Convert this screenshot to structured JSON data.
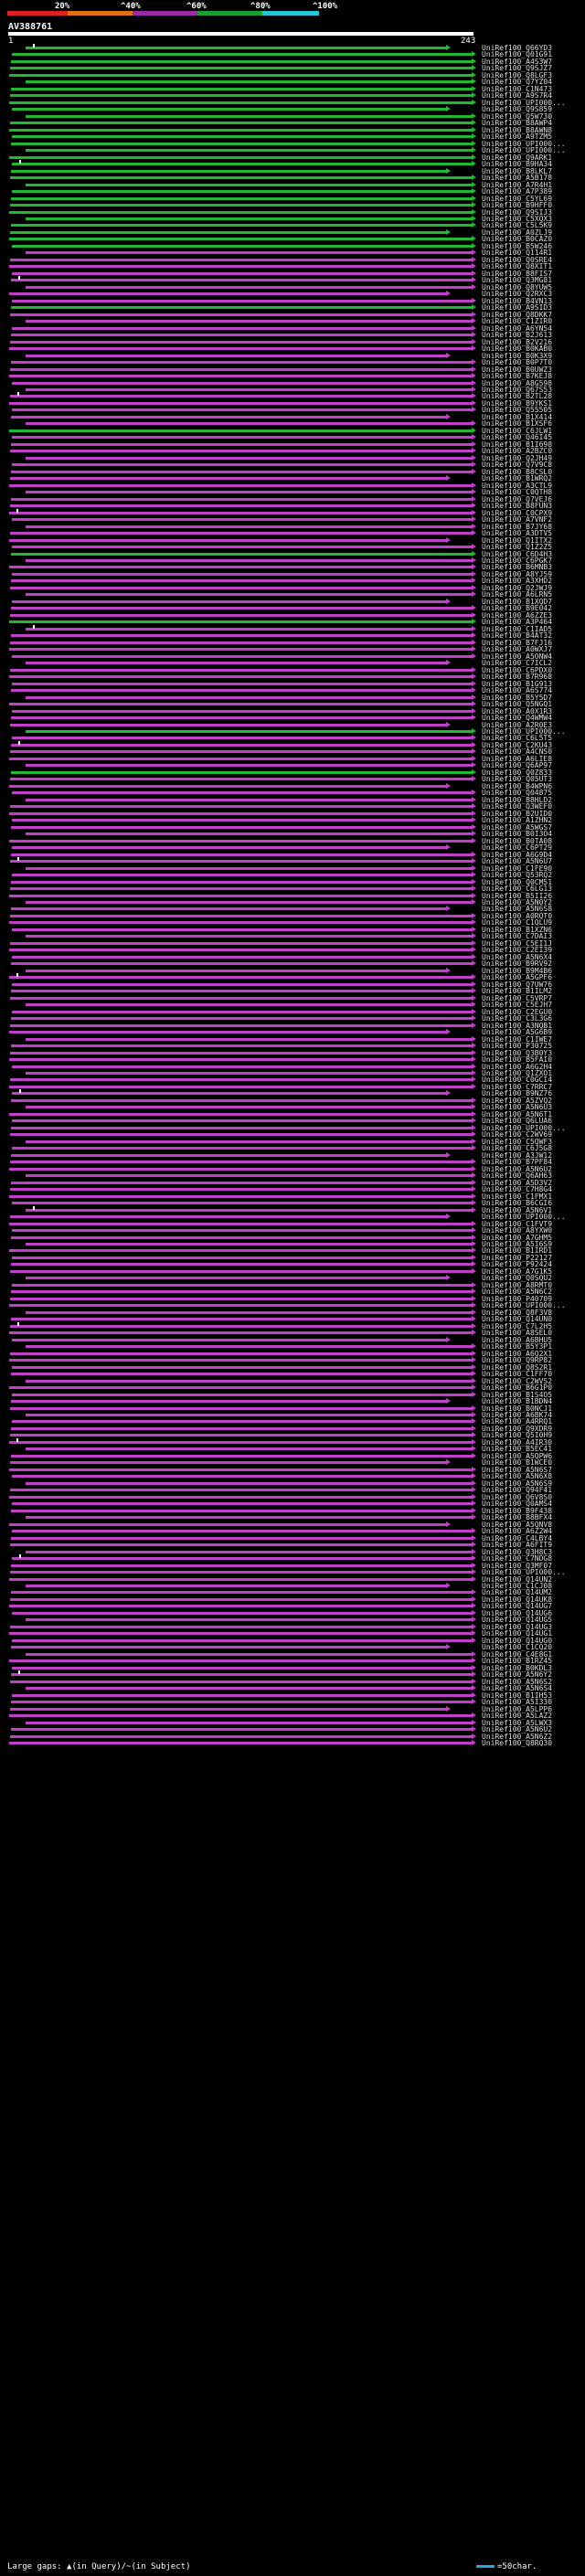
{
  "scale": {
    "labels": [
      "20%",
      "^40%",
      "^60%",
      "^80%",
      "^100%"
    ],
    "colors": [
      "#e02020",
      "#e07010",
      "#9a2aa8",
      "#1aa030",
      "#20c8d8"
    ]
  },
  "query": {
    "title": "AV388761",
    "start_label": "1",
    "end_label": "243"
  },
  "legend": {
    "text": "Large gaps: ▲(in Query)/~(in Subject)",
    "scale_text": "=50char."
  },
  "hits": [
    {
      "label": "UniRef100_Q66YD3",
      "color": "green"
    },
    {
      "label": "UniRef100_Q01G91",
      "color": "green"
    },
    {
      "label": "UniRef100_A4S3W7",
      "color": "green"
    },
    {
      "label": "UniRef100_Q9SJZ7",
      "color": "green"
    },
    {
      "label": "UniRef100_Q8LGF3",
      "color": "green"
    },
    {
      "label": "UniRef100_Q7YZ04",
      "color": "green"
    },
    {
      "label": "UniRef100_C1N473",
      "color": "green"
    },
    {
      "label": "UniRef100_A9S7R4",
      "color": "green"
    },
    {
      "label": "UniRef100_UPI000...",
      "color": "green"
    },
    {
      "label": "UniRef100_Q9S859",
      "color": "green"
    },
    {
      "label": "UniRef100_Q5W730",
      "color": "green"
    },
    {
      "label": "UniRef100_B8AWP4",
      "color": "green"
    },
    {
      "label": "UniRef100_B8AWN8",
      "color": "green"
    },
    {
      "label": "UniRef100_A9TZM5",
      "color": "green"
    },
    {
      "label": "UniRef100_UPI000...",
      "color": "green"
    },
    {
      "label": "UniRef100_UPI000...",
      "color": "green"
    },
    {
      "label": "UniRef100_Q9ARK1",
      "color": "green"
    },
    {
      "label": "UniRef100_B9HA34",
      "color": "green"
    },
    {
      "label": "UniRef100_B8LKL7",
      "color": "green"
    },
    {
      "label": "UniRef100_A5B178",
      "color": "green"
    },
    {
      "label": "UniRef100_A7R4H1",
      "color": "green"
    },
    {
      "label": "UniRef100_A7P389",
      "color": "green"
    },
    {
      "label": "UniRef100_C5YL69",
      "color": "green"
    },
    {
      "label": "UniRef100_B9HFF0",
      "color": "green"
    },
    {
      "label": "UniRef100_Q9SIJ3",
      "color": "green"
    },
    {
      "label": "UniRef100_C5XQX3",
      "color": "green"
    },
    {
      "label": "UniRef100_C5L5K9",
      "color": "green"
    },
    {
      "label": "UniRef100_A0ZLJ9",
      "color": "green"
    },
    {
      "label": "UniRef100_B0CAZ0",
      "color": "green"
    },
    {
      "label": "UniRef100_B5W246",
      "color": "green"
    },
    {
      "label": "UniRef100_Q114R1",
      "color": "magenta"
    },
    {
      "label": "UniRef100_Q0SRE4",
      "color": "magenta"
    },
    {
      "label": "UniRef100_Q8XIT1",
      "color": "magenta"
    },
    {
      "label": "UniRef100_B8FIS7",
      "color": "magenta"
    },
    {
      "label": "UniRef100_Q3MG81",
      "color": "magenta"
    },
    {
      "label": "UniRef100_Q8YUW5",
      "color": "magenta"
    },
    {
      "label": "UniRef100_Q2RXC3",
      "color": "magenta"
    },
    {
      "label": "UniRef100_B4VN13",
      "color": "magenta"
    },
    {
      "label": "UniRef100_A9SID3",
      "color": "green"
    },
    {
      "label": "UniRef100_Q8DKK7",
      "color": "magenta"
    },
    {
      "label": "UniRef100_C1ZIR0",
      "color": "magenta"
    },
    {
      "label": "UniRef100_A6YN54",
      "color": "magenta"
    },
    {
      "label": "UniRef100_B2J613",
      "color": "magenta"
    },
    {
      "label": "UniRef100_B2V216",
      "color": "magenta"
    },
    {
      "label": "UniRef100_B0KAB0",
      "color": "magenta"
    },
    {
      "label": "UniRef100_B0K3X9",
      "color": "magenta"
    },
    {
      "label": "UniRef100_B0P7T0",
      "color": "magenta"
    },
    {
      "label": "UniRef100_B0UWZ3",
      "color": "magenta"
    },
    {
      "label": "UniRef100_B7KEJ8",
      "color": "magenta"
    },
    {
      "label": "UniRef100_A8G598",
      "color": "magenta"
    },
    {
      "label": "UniRef100_Q67S53",
      "color": "magenta"
    },
    {
      "label": "UniRef100_B2TL28",
      "color": "magenta"
    },
    {
      "label": "UniRef100_B9YKS1",
      "color": "magenta"
    },
    {
      "label": "UniRef100_Q55505",
      "color": "magenta"
    },
    {
      "label": "UniRef100_B1X414",
      "color": "magenta"
    },
    {
      "label": "UniRef100_B1XSF6",
      "color": "magenta"
    },
    {
      "label": "UniRef100_C6JLW1",
      "color": "green"
    },
    {
      "label": "UniRef100_Q46I45",
      "color": "magenta"
    },
    {
      "label": "UniRef100_B1I698",
      "color": "magenta"
    },
    {
      "label": "UniRef100_A2BZC0",
      "color": "magenta"
    },
    {
      "label": "UniRef100_Q2JH49",
      "color": "magenta"
    },
    {
      "label": "UniRef100_Q7V9C8",
      "color": "magenta"
    },
    {
      "label": "UniRef100_B8CSL0",
      "color": "magenta"
    },
    {
      "label": "UniRef100_B1WRQ2",
      "color": "magenta"
    },
    {
      "label": "UniRef100_A3CTL9",
      "color": "magenta"
    },
    {
      "label": "UniRef100_C0QTH8",
      "color": "magenta"
    },
    {
      "label": "UniRef100_Q7VEJ6",
      "color": "magenta"
    },
    {
      "label": "UniRef100_B8FUN3",
      "color": "magenta"
    },
    {
      "label": "UniRef100_C0CPX9",
      "color": "magenta"
    },
    {
      "label": "UniRef100_A7VNF2",
      "color": "magenta"
    },
    {
      "label": "UniRef100_B7JY68",
      "color": "magenta"
    },
    {
      "label": "UniRef100_A3DTV5",
      "color": "magenta"
    },
    {
      "label": "UniRef100_Q1ITX2",
      "color": "magenta"
    },
    {
      "label": "UniRef100_Q1Z2Z5",
      "color": "magenta"
    },
    {
      "label": "UniRef100_C6D4H3",
      "color": "green"
    },
    {
      "label": "UniRef100_C6PGK7",
      "color": "magenta"
    },
    {
      "label": "UniRef100_B6MNB3",
      "color": "magenta"
    },
    {
      "label": "UniRef100_A8YJ59",
      "color": "magenta"
    },
    {
      "label": "UniRef100_A3XHD2",
      "color": "magenta"
    },
    {
      "label": "UniRef100_Q2JWJ9",
      "color": "magenta"
    },
    {
      "label": "UniRef100_A6LRN5",
      "color": "magenta"
    },
    {
      "label": "UniRef100_B1XQD7",
      "color": "magenta"
    },
    {
      "label": "UniRef100_B9E042",
      "color": "magenta"
    },
    {
      "label": "UniRef100_A6ZZE3",
      "color": "magenta"
    },
    {
      "label": "UniRef100_A3P464",
      "color": "green"
    },
    {
      "label": "UniRef100_C1IAD5",
      "color": "magenta"
    },
    {
      "label": "UniRef100_B4AT32",
      "color": "magenta"
    },
    {
      "label": "UniRef100_B7FJ16",
      "color": "magenta"
    },
    {
      "label": "UniRef100_A0WXJ7",
      "color": "magenta"
    },
    {
      "label": "UniRef100_A5ONW4",
      "color": "magenta"
    },
    {
      "label": "UniRef100_C7ICL2",
      "color": "magenta"
    },
    {
      "label": "UniRef100_C6PDX0",
      "color": "magenta"
    },
    {
      "label": "UniRef100_B7R968",
      "color": "magenta"
    },
    {
      "label": "UniRef100_B1G913",
      "color": "magenta"
    },
    {
      "label": "UniRef100_A6S774",
      "color": "magenta"
    },
    {
      "label": "UniRef100_B5Y5D7",
      "color": "magenta"
    },
    {
      "label": "UniRef100_Q5NGQ1",
      "color": "magenta"
    },
    {
      "label": "UniRef100_A0X1R3",
      "color": "magenta"
    },
    {
      "label": "UniRef100_Q4WMW4",
      "color": "magenta"
    },
    {
      "label": "UniRef100_A2R0E3",
      "color": "magenta"
    },
    {
      "label": "UniRef100_UPI000...",
      "color": "green"
    },
    {
      "label": "UniRef100_C6L5T5",
      "color": "magenta"
    },
    {
      "label": "UniRef100_C2KU43",
      "color": "magenta"
    },
    {
      "label": "UniRef100_A4CNS0",
      "color": "magenta"
    },
    {
      "label": "UniRef100_A6LIE8",
      "color": "magenta"
    },
    {
      "label": "UniRef100_Q6AP97",
      "color": "magenta"
    },
    {
      "label": "UniRef100_Q0Z833",
      "color": "green"
    },
    {
      "label": "UniRef100_Q05UT3",
      "color": "magenta"
    },
    {
      "label": "UniRef100_B4WPN6",
      "color": "magenta"
    },
    {
      "label": "UniRef100_Q04875",
      "color": "magenta"
    },
    {
      "label": "UniRef100_B8HLD2",
      "color": "magenta"
    },
    {
      "label": "UniRef100_Q3WEF0",
      "color": "magenta"
    },
    {
      "label": "UniRef100_B2UID0",
      "color": "magenta"
    },
    {
      "label": "UniRef100_A1ZHN2",
      "color": "magenta"
    },
    {
      "label": "UniRef100_A5WGS7",
      "color": "magenta"
    },
    {
      "label": "UniRef100_B0I3O4",
      "color": "magenta"
    },
    {
      "label": "UniRef100_B0TA08",
      "color": "magenta"
    },
    {
      "label": "UniRef100_C6PT29",
      "color": "magenta"
    },
    {
      "label": "UniRef100_A6G9D4",
      "color": "magenta"
    },
    {
      "label": "UniRef100_A5N6U7",
      "color": "magenta"
    },
    {
      "label": "UniRef100_C1FE90",
      "color": "magenta"
    },
    {
      "label": "UniRef100_Q53RQ2",
      "color": "magenta"
    },
    {
      "label": "UniRef100_Q0CM51",
      "color": "magenta"
    },
    {
      "label": "UniRef100_C6LG13",
      "color": "magenta"
    },
    {
      "label": "UniRef100_B5II26",
      "color": "magenta"
    },
    {
      "label": "UniRef100_A5N0Y2",
      "color": "magenta"
    },
    {
      "label": "UniRef100_A5N6S8",
      "color": "magenta"
    },
    {
      "label": "UniRef100_A0RQT0",
      "color": "magenta"
    },
    {
      "label": "UniRef100_C1QLU9",
      "color": "magenta"
    },
    {
      "label": "UniRef100_B1XZN6",
      "color": "magenta"
    },
    {
      "label": "UniRef100_C7DAI3",
      "color": "magenta"
    },
    {
      "label": "UniRef100_C5EI1J",
      "color": "magenta"
    },
    {
      "label": "UniRef100_C2EI39",
      "color": "magenta"
    },
    {
      "label": "UniRef100_A5N6X4",
      "color": "magenta"
    },
    {
      "label": "UniRef100_B9RV92",
      "color": "magenta"
    },
    {
      "label": "UniRef100_B9M4B6",
      "color": "magenta"
    },
    {
      "label": "UniRef100_A5GPF6",
      "color": "magenta"
    },
    {
      "label": "UniRef100_Q7UW76",
      "color": "magenta"
    },
    {
      "label": "UniRef100_B1ILM2",
      "color": "magenta"
    },
    {
      "label": "UniRef100_C5VRP7",
      "color": "magenta"
    },
    {
      "label": "UniRef100_C5EJH7",
      "color": "magenta"
    },
    {
      "label": "UniRef100_C2EGU0",
      "color": "magenta"
    },
    {
      "label": "UniRef100_C3L3G6",
      "color": "magenta"
    },
    {
      "label": "UniRef100_A3NQB1",
      "color": "magenta"
    },
    {
      "label": "UniRef100_A5G6B9",
      "color": "magenta"
    },
    {
      "label": "UniRef100_C1IWE7",
      "color": "magenta"
    },
    {
      "label": "UniRef100_P30725",
      "color": "magenta"
    },
    {
      "label": "UniRef100_Q3B0Y3",
      "color": "magenta"
    },
    {
      "label": "UniRef100_B5FAI0",
      "color": "magenta"
    },
    {
      "label": "UniRef100_A6G2H4",
      "color": "magenta"
    },
    {
      "label": "UniRef100_Q1ZXO1",
      "color": "magenta"
    },
    {
      "label": "UniRef100_C0GCI4",
      "color": "magenta"
    },
    {
      "label": "UniRef100_C7RRC7",
      "color": "magenta"
    },
    {
      "label": "UniRef100_B9NZ76",
      "color": "magenta"
    },
    {
      "label": "UniRef100_A5ZVQ2",
      "color": "magenta"
    },
    {
      "label": "UniRef100_A5N6U3",
      "color": "magenta"
    },
    {
      "label": "UniRef100_A5N6T1",
      "color": "magenta"
    },
    {
      "label": "UniRef100_Q6LUA6",
      "color": "magenta"
    },
    {
      "label": "UniRef100_UPI000...",
      "color": "magenta"
    },
    {
      "label": "UniRef100_C2WV69",
      "color": "magenta"
    },
    {
      "label": "UniRef100_C5QWF3",
      "color": "magenta"
    },
    {
      "label": "UniRef100_C6J5G8",
      "color": "magenta"
    },
    {
      "label": "UniRef100_A3JW12",
      "color": "magenta"
    },
    {
      "label": "UniRef100_B7PF84",
      "color": "magenta"
    },
    {
      "label": "UniRef100_A5N6U2",
      "color": "magenta"
    },
    {
      "label": "UniRef100_Q6AH63",
      "color": "magenta"
    },
    {
      "label": "UniRef100_A5D3V2",
      "color": "magenta"
    },
    {
      "label": "UniRef100_C7H8G4",
      "color": "magenta"
    },
    {
      "label": "UniRef100_C1FMX1",
      "color": "magenta"
    },
    {
      "label": "UniRef100_B6CGI6",
      "color": "magenta"
    },
    {
      "label": "UniRef100_A5N6V1",
      "color": "magenta"
    },
    {
      "label": "UniRef100_UPI000...",
      "color": "magenta"
    },
    {
      "label": "UniRef100_C1FVT9",
      "color": "magenta"
    },
    {
      "label": "UniRef100_A8YXW0",
      "color": "magenta"
    },
    {
      "label": "UniRef100_A7GHM5",
      "color": "magenta"
    },
    {
      "label": "UniRef100_A5I6S9",
      "color": "magenta"
    },
    {
      "label": "UniRef100_B1IRD1",
      "color": "magenta"
    },
    {
      "label": "UniRef100_P22127",
      "color": "magenta"
    },
    {
      "label": "UniRef100_P92424",
      "color": "magenta"
    },
    {
      "label": "UniRef100_A7G1K5",
      "color": "magenta"
    },
    {
      "label": "UniRef100_Q0SQU2",
      "color": "magenta"
    },
    {
      "label": "UniRef100_A8RMT0",
      "color": "magenta"
    },
    {
      "label": "UniRef100_A5N6C2",
      "color": "magenta"
    },
    {
      "label": "UniRef100_P40709",
      "color": "magenta"
    },
    {
      "label": "UniRef100_UPI000...",
      "color": "magenta"
    },
    {
      "label": "UniRef100_Q8F3V8",
      "color": "magenta"
    },
    {
      "label": "UniRef100_Q14UN0",
      "color": "magenta"
    },
    {
      "label": "UniRef100_C7L2H5",
      "color": "magenta"
    },
    {
      "label": "UniRef100_A8SEL0",
      "color": "magenta"
    },
    {
      "label": "UniRef100_A6BHU5",
      "color": "magenta"
    },
    {
      "label": "UniRef100_B5Y3P1",
      "color": "magenta"
    },
    {
      "label": "UniRef100_A6Q2X1",
      "color": "magenta"
    },
    {
      "label": "UniRef100_Q9RP82",
      "color": "magenta"
    },
    {
      "label": "UniRef100_Q8S2R1",
      "color": "magenta"
    },
    {
      "label": "UniRef100_C1FF70",
      "color": "magenta"
    },
    {
      "label": "UniRef100_C2WVS2",
      "color": "magenta"
    },
    {
      "label": "UniRef100_B6G1P0",
      "color": "magenta"
    },
    {
      "label": "UniRef100_B1S4O5",
      "color": "magenta"
    },
    {
      "label": "UniRef100_B1BDN4",
      "color": "magenta"
    },
    {
      "label": "UniRef100_B0NCJ1",
      "color": "magenta"
    },
    {
      "label": "UniRef100_A6BK74",
      "color": "magenta"
    },
    {
      "label": "UniRef100_A4RRQ1",
      "color": "magenta"
    },
    {
      "label": "UniRef100_Q9XDR9",
      "color": "magenta"
    },
    {
      "label": "UniRef100_Q5I0H9",
      "color": "magenta"
    },
    {
      "label": "UniRef100_A4IR30",
      "color": "magenta"
    },
    {
      "label": "UniRef100_B5EC41",
      "color": "magenta"
    },
    {
      "label": "UniRef100_A5QPW6",
      "color": "magenta"
    },
    {
      "label": "UniRef100_B1WCE0",
      "color": "magenta"
    },
    {
      "label": "UniRef100_A5N6S7",
      "color": "magenta"
    },
    {
      "label": "UniRef100_A5N6X8",
      "color": "magenta"
    },
    {
      "label": "UniRef100_A5N6S9",
      "color": "magenta"
    },
    {
      "label": "UniRef100_Q94F41",
      "color": "magenta"
    },
    {
      "label": "UniRef100_Q6V8S0",
      "color": "magenta"
    },
    {
      "label": "UniRef100_Q0AMS4",
      "color": "magenta"
    },
    {
      "label": "UniRef100_B9F438",
      "color": "magenta"
    },
    {
      "label": "UniRef100_B8BFX4",
      "color": "magenta"
    },
    {
      "label": "UniRef100_A5QNV8",
      "color": "magenta"
    },
    {
      "label": "UniRef100_A6Z2W4",
      "color": "magenta"
    },
    {
      "label": "UniRef100_C4LBY4",
      "color": "magenta"
    },
    {
      "label": "UniRef100_A6FIT9",
      "color": "magenta"
    },
    {
      "label": "UniRef100_Q3H8C3",
      "color": "magenta"
    },
    {
      "label": "UniRef100_C7NDG8",
      "color": "magenta"
    },
    {
      "label": "UniRef100_Q3MF07",
      "color": "magenta"
    },
    {
      "label": "UniRef100_UPI000...",
      "color": "magenta"
    },
    {
      "label": "UniRef100_Q14UN2",
      "color": "magenta"
    },
    {
      "label": "UniRef100_C1CJ08",
      "color": "magenta"
    },
    {
      "label": "UniRef100_Q14UM2",
      "color": "magenta"
    },
    {
      "label": "UniRef100_Q14UK8",
      "color": "magenta"
    },
    {
      "label": "UniRef100_Q14UG7",
      "color": "magenta"
    },
    {
      "label": "UniRef100_Q14UG6",
      "color": "magenta"
    },
    {
      "label": "UniRef100_Q14UG5",
      "color": "magenta"
    },
    {
      "label": "UniRef100_Q14UG3",
      "color": "magenta"
    },
    {
      "label": "UniRef100_Q14UG1",
      "color": "magenta"
    },
    {
      "label": "UniRef100_Q14UG0",
      "color": "magenta"
    },
    {
      "label": "UniRef100_C1CQ20",
      "color": "magenta"
    },
    {
      "label": "UniRef100_C4E8G1",
      "color": "magenta"
    },
    {
      "label": "UniRef100_B1RZ45",
      "color": "magenta"
    },
    {
      "label": "UniRef100_B0KDL3",
      "color": "magenta"
    },
    {
      "label": "UniRef100_A5N6Y2",
      "color": "magenta"
    },
    {
      "label": "UniRef100_A5N6S2",
      "color": "magenta"
    },
    {
      "label": "UniRef100_A5N6S4",
      "color": "magenta"
    },
    {
      "label": "UniRef100_B1IH53",
      "color": "magenta"
    },
    {
      "label": "UniRef100_A5I330",
      "color": "magenta"
    },
    {
      "label": "UniRef100_A5LPP6",
      "color": "magenta"
    },
    {
      "label": "UniRef100_A5LAZ2",
      "color": "magenta"
    },
    {
      "label": "UniRef100_A5LWX3",
      "color": "magenta"
    },
    {
      "label": "UniRef100_A5N6U2",
      "color": "magenta"
    },
    {
      "label": "UniRef100_A5N6Z2",
      "color": "magenta"
    },
    {
      "label": "UniRef100_Q8RQ30",
      "color": "magenta"
    }
  ]
}
